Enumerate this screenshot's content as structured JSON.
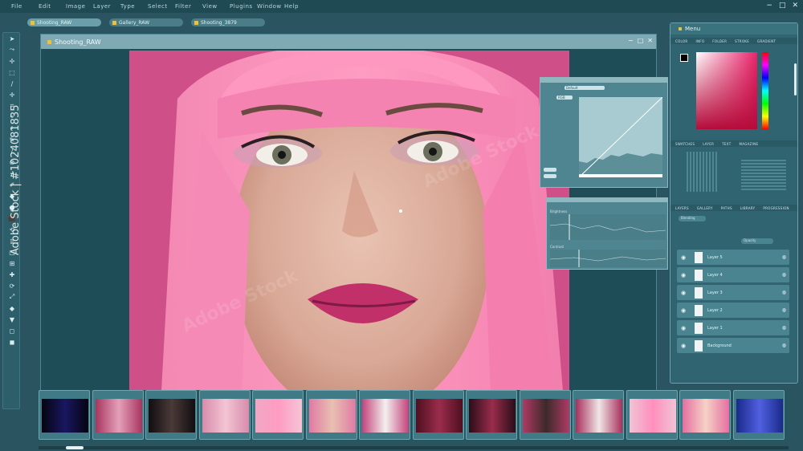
{
  "menu": [
    "File",
    "Edit",
    "Image",
    "Layer",
    "Type",
    "Select",
    "Filter",
    "View",
    "Plugins",
    "Window",
    "Help"
  ],
  "window_controls": [
    "−",
    "□",
    "✕"
  ],
  "tabs": [
    "Shooting_RAW",
    "Gallery_RAW",
    "Shooting_3879"
  ],
  "document": {
    "title": "Shooting_RAW",
    "controls": [
      "−",
      "□",
      "✕"
    ]
  },
  "tools": [
    "➤",
    "⤳",
    "✢",
    "⬚",
    "∕",
    "✛",
    "⌗",
    "⌖",
    "!",
    "✎",
    "∕",
    "⊘",
    "∕",
    "✐",
    "◆",
    "●",
    "⬛",
    "⟲",
    "⌗",
    "▢",
    "⊞",
    "✚",
    "⟳",
    "⤢",
    "◆",
    "▼",
    "◻",
    "◼"
  ],
  "panel": {
    "title": "Menu",
    "sections": [
      "COLOR",
      "INFO",
      "FOLDER",
      "STROKE",
      "GRADIENT",
      "SWATCHES",
      "LAYER",
      "TEXT",
      "MAGAZINE",
      "LAYERS",
      "GALLERY",
      "PATHS",
      "LIBRARY",
      "PROGRESSION"
    ],
    "layers": [
      "Layer 5",
      "Layer 4",
      "Layer 3",
      "Layer 2",
      "Layer 1",
      "Background"
    ],
    "blend_mode": "Blending",
    "opacity_label": "Opacity"
  },
  "curves": {
    "preset": "Default",
    "channel": "RGB"
  },
  "levels": {
    "label1": "Brightness",
    "label2": "Contrast"
  },
  "watermark": "Adobe Stock | #1024081835",
  "stock_mark": "Adobe Stock",
  "colors": {
    "accent": "#e6c24a",
    "bg": "#2a5560"
  }
}
